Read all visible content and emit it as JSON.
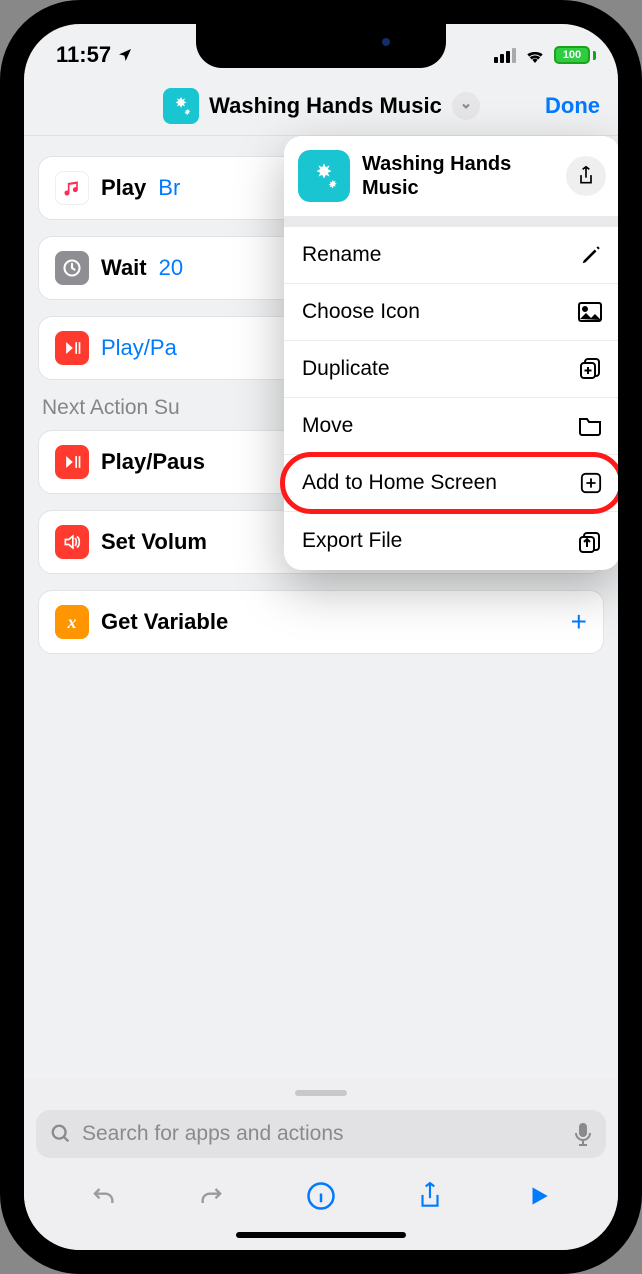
{
  "status": {
    "time": "11:57",
    "battery": "100"
  },
  "header": {
    "title": "Washing Hands Music",
    "done": "Done"
  },
  "cards": {
    "play": {
      "label": "Play",
      "token": "Br"
    },
    "wait": {
      "label": "Wait",
      "token": "20"
    },
    "playpause": {
      "label": "Play/Pa"
    }
  },
  "section": {
    "title": "Next Action Su"
  },
  "suggestions": {
    "playpause": {
      "label": "Play/Paus"
    },
    "volume": {
      "label": "Set Volum"
    },
    "variable": {
      "label": "Get Variable"
    }
  },
  "popup": {
    "title": "Washing Hands Music",
    "items": {
      "rename": "Rename",
      "choose_icon": "Choose Icon",
      "duplicate": "Duplicate",
      "move": "Move",
      "add_home": "Add to Home Screen",
      "export": "Export File"
    }
  },
  "search": {
    "placeholder": "Search for apps and actions"
  }
}
